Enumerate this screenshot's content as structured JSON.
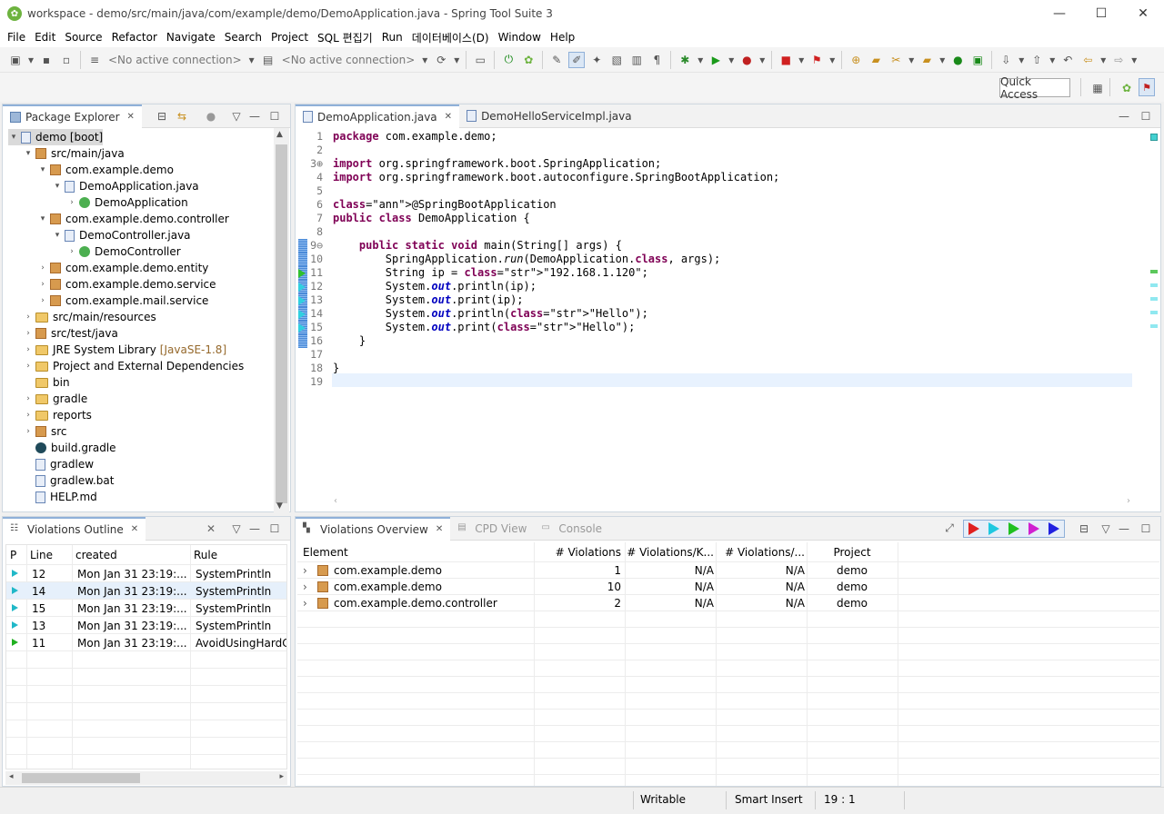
{
  "window": {
    "title": "workspace - demo/src/main/java/com/example/demo/DemoApplication.java - Spring Tool Suite 3"
  },
  "menu": [
    "File",
    "Edit",
    "Source",
    "Refactor",
    "Navigate",
    "Search",
    "Project",
    "SQL 편집기",
    "Run",
    "데이터베이스(D)",
    "Window",
    "Help"
  ],
  "toolbar": {
    "connection1": "<No active connection>",
    "connection2": "<No active connection>",
    "quick_access": "Quick Access"
  },
  "package_explorer": {
    "tab": "Package Explorer",
    "items": [
      {
        "label": "demo [boot]",
        "indent": 0,
        "arrow": "v",
        "icon": "project"
      },
      {
        "label": "src/main/java",
        "indent": 1,
        "arrow": "v",
        "icon": "srcfolder"
      },
      {
        "label": "com.example.demo",
        "indent": 2,
        "arrow": "v",
        "icon": "pkg"
      },
      {
        "label": "DemoApplication.java",
        "indent": 3,
        "arrow": "v",
        "icon": "jfile"
      },
      {
        "label": "DemoApplication",
        "indent": 4,
        "arrow": ">",
        "icon": "cls"
      },
      {
        "label": "com.example.demo.controller",
        "indent": 2,
        "arrow": "v",
        "icon": "pkg"
      },
      {
        "label": "DemoController.java",
        "indent": 3,
        "arrow": "v",
        "icon": "jfile"
      },
      {
        "label": "DemoController",
        "indent": 4,
        "arrow": ">",
        "icon": "cls"
      },
      {
        "label": "com.example.demo.entity",
        "indent": 2,
        "arrow": ">",
        "icon": "pkg"
      },
      {
        "label": "com.example.demo.service",
        "indent": 2,
        "arrow": ">",
        "icon": "pkg"
      },
      {
        "label": "com.example.mail.service",
        "indent": 2,
        "arrow": ">",
        "icon": "pkg"
      },
      {
        "label": "src/main/resources",
        "indent": 1,
        "arrow": ">",
        "icon": "folder"
      },
      {
        "label": "src/test/java",
        "indent": 1,
        "arrow": ">",
        "icon": "srcfolder"
      },
      {
        "label": "JRE System Library",
        "extra": "[JavaSE-1.8]",
        "indent": 1,
        "arrow": ">",
        "icon": "lib"
      },
      {
        "label": "Project and External Dependencies",
        "indent": 1,
        "arrow": ">",
        "icon": "lib"
      },
      {
        "label": "bin",
        "indent": 1,
        "arrow": "",
        "icon": "folder"
      },
      {
        "label": "gradle",
        "indent": 1,
        "arrow": ">",
        "icon": "folder"
      },
      {
        "label": "reports",
        "indent": 1,
        "arrow": ">",
        "icon": "folder"
      },
      {
        "label": "src",
        "indent": 1,
        "arrow": ">",
        "icon": "srcfolder"
      },
      {
        "label": "build.gradle",
        "indent": 1,
        "arrow": "",
        "icon": "gradle"
      },
      {
        "label": "gradlew",
        "indent": 1,
        "arrow": "",
        "icon": "file"
      },
      {
        "label": "gradlew.bat",
        "indent": 1,
        "arrow": "",
        "icon": "file"
      },
      {
        "label": "HELP.md",
        "indent": 1,
        "arrow": "",
        "icon": "file"
      }
    ]
  },
  "editor": {
    "tabs": [
      "DemoApplication.java",
      "DemoHelloServiceImpl.java"
    ],
    "lines": [
      {
        "n": "1",
        "t": "package com.example.demo;"
      },
      {
        "n": "2",
        "t": ""
      },
      {
        "n": "3⊕",
        "t": "import org.springframework.boot.SpringApplication;"
      },
      {
        "n": "4",
        "t": "import org.springframework.boot.autoconfigure.SpringBootApplication;"
      },
      {
        "n": "5",
        "t": ""
      },
      {
        "n": "6",
        "t": "@SpringBootApplication"
      },
      {
        "n": "7",
        "t": "public class DemoApplication {"
      },
      {
        "n": "8",
        "t": ""
      },
      {
        "n": "9⊖",
        "t": "    public static void main(String[] args) {"
      },
      {
        "n": "10",
        "t": "        SpringApplication.run(DemoApplication.class, args);"
      },
      {
        "n": "11",
        "t": "        String ip = \"192.168.1.120\";"
      },
      {
        "n": "12",
        "t": "        System.out.println(ip);"
      },
      {
        "n": "13",
        "t": "        System.out.print(ip);"
      },
      {
        "n": "14",
        "t": "        System.out.println(\"Hello\");"
      },
      {
        "n": "15",
        "t": "        System.out.print(\"Hello\");"
      },
      {
        "n": "16",
        "t": "    }"
      },
      {
        "n": "17",
        "t": ""
      },
      {
        "n": "18",
        "t": "}"
      },
      {
        "n": "19",
        "t": ""
      }
    ]
  },
  "violations_outline": {
    "tab": "Violations Outline",
    "columns": [
      "P",
      "Line",
      "created",
      "Rule"
    ],
    "rows": [
      {
        "p": "cyan",
        "line": "12",
        "created": "Mon Jan 31 23:19:...",
        "rule": "SystemPrintln"
      },
      {
        "p": "cyan",
        "line": "14",
        "created": "Mon Jan 31 23:19:...",
        "rule": "SystemPrintln"
      },
      {
        "p": "cyan",
        "line": "15",
        "created": "Mon Jan 31 23:19:...",
        "rule": "SystemPrintln"
      },
      {
        "p": "cyan",
        "line": "13",
        "created": "Mon Jan 31 23:19:...",
        "rule": "SystemPrintln"
      },
      {
        "p": "green",
        "line": "11",
        "created": "Mon Jan 31 23:19:...",
        "rule": "AvoidUsingHardCo"
      }
    ]
  },
  "violations_overview": {
    "tabs": [
      "Violations Overview",
      "CPD View",
      "Console"
    ],
    "columns": [
      "Element",
      "# Violations",
      "# Violations/K...",
      "# Violations/...",
      "Project"
    ],
    "rows": [
      {
        "element": "com.example.demo",
        "v": "1",
        "vk": "N/A",
        "vm": "N/A",
        "project": "demo"
      },
      {
        "element": "com.example.demo",
        "v": "10",
        "vk": "N/A",
        "vm": "N/A",
        "project": "demo"
      },
      {
        "element": "com.example.demo.controller",
        "v": "2",
        "vk": "N/A",
        "vm": "N/A",
        "project": "demo"
      }
    ]
  },
  "status": {
    "writable": "Writable",
    "insert": "Smart Insert",
    "position": "19 : 1"
  }
}
